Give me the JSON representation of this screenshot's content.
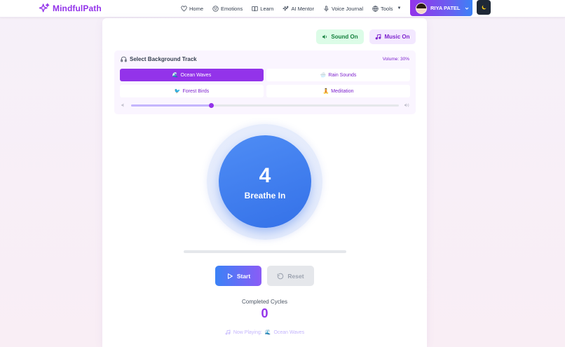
{
  "app": {
    "brand": "MindfulPath",
    "accent_color": "#9333ea"
  },
  "nav": {
    "items": [
      {
        "label": "Home",
        "icon": "heart-icon"
      },
      {
        "label": "Emotions",
        "icon": "smile-icon"
      },
      {
        "label": "Learn",
        "icon": "book-icon"
      },
      {
        "label": "AI Mentor",
        "icon": "sparkles-icon"
      },
      {
        "label": "Voice Journal",
        "icon": "microphone-icon"
      },
      {
        "label": "Tools",
        "icon": "globe-icon",
        "has_dropdown": true
      }
    ],
    "user": {
      "name": "RIYA PATEL"
    },
    "theme_toggle_icon": "moon-icon"
  },
  "toggles": {
    "sound": "Sound On",
    "music": "Music On"
  },
  "tracks": {
    "header": "Select Background Track",
    "volume_label": "Volume: 30%",
    "volume": 0.3,
    "options": [
      {
        "label": "Ocean Waves",
        "emoji": "🌊",
        "active": true
      },
      {
        "label": "Rain Sounds",
        "emoji": "🌧️",
        "active": false
      },
      {
        "label": "Forest Birds",
        "emoji": "🐦",
        "active": false
      },
      {
        "label": "Meditation",
        "emoji": "🧘",
        "active": false
      }
    ]
  },
  "breathing": {
    "count": "4",
    "phase": "Breathe In",
    "progress": 0
  },
  "controls": {
    "start": "Start",
    "reset": "Reset"
  },
  "stats": {
    "cycles_label": "Completed Cycles",
    "cycles_value": "0"
  },
  "now_playing": {
    "label": "Now Playing:",
    "emoji": "🌊",
    "track": "Ocean Waves"
  }
}
